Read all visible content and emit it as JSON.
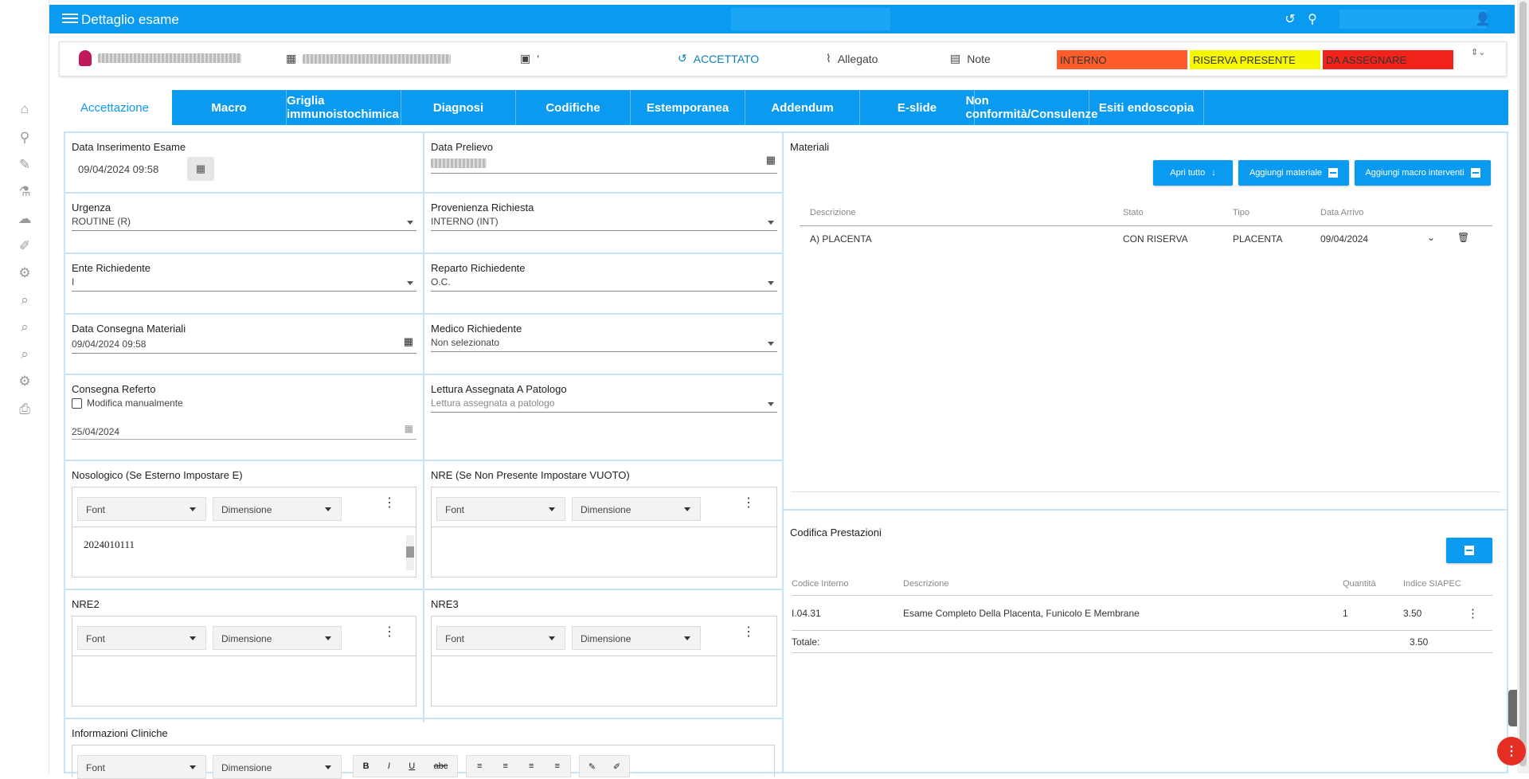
{
  "app": {
    "title": "Dettaglio esame"
  },
  "header": {
    "patient_name_hidden": "",
    "date_hidden": "",
    "folder_value": "'",
    "status": "ACCETTATO",
    "attachment_label": "Allegato",
    "notes_label": "Note",
    "chips": [
      {
        "label": "INTERNO",
        "color": "#ff5c2b"
      },
      {
        "label": "RISERVA PRESENTE",
        "color": "#f6f600"
      },
      {
        "label": "DA ASSEGNARE",
        "color": "#f2231a"
      }
    ]
  },
  "tabs": [
    "Accettazione",
    "Macro",
    "Griglia immunoistochimica",
    "Diagnosi",
    "Codifiche",
    "Estemporanea",
    "Addendum",
    "E-slide",
    "Non conformità/Consulenze",
    "Esiti endoscopia"
  ],
  "form": {
    "data_inserimento": {
      "label": "Data Inserimento Esame",
      "value": "09/04/2024 09:58"
    },
    "data_prelievo": {
      "label": "Data Prelievo"
    },
    "urgenza": {
      "label": "Urgenza",
      "value": "ROUTINE (R)"
    },
    "provenienza": {
      "label": "Provenienza Richiesta",
      "value": "INTERNO (INT)"
    },
    "ente": {
      "label": "Ente Richiedente",
      "value": "I"
    },
    "reparto": {
      "label": "Reparto Richiedente",
      "value": "O.C."
    },
    "consegna_materiali": {
      "label": "Data Consegna Materiali",
      "value": "09/04/2024 09:58"
    },
    "medico": {
      "label": "Medico Richiedente",
      "value": "Non selezionato"
    },
    "consegna_referto": {
      "label": "Consegna Referto",
      "checkbox_label": "Modifica manualmente",
      "value": "25/04/2024"
    },
    "lettura": {
      "label": "Lettura Assegnata A Patologo",
      "placeholder": "Lettura assegnata a patologo"
    },
    "nosologico": {
      "label": "Nosologico (Se Esterno Impostare E)",
      "value": "2024010111"
    },
    "nre": {
      "label": "NRE (Se Non Presente Impostare VUOTO)"
    },
    "nre2": {
      "label": "NRE2"
    },
    "nre3": {
      "label": "NRE3"
    },
    "info_cliniche": {
      "label": "Informazioni Cliniche"
    },
    "editor": {
      "font": "Font",
      "size": "Dimensione"
    }
  },
  "materiali": {
    "title": "Materiali",
    "buttons": {
      "apri": "Apri tutto",
      "aggiungi": "Aggiungi materiale",
      "macro": "Aggiungi macro interventi"
    },
    "columns": [
      "Descrizione",
      "Stato",
      "Tipo",
      "Data Arrivo"
    ],
    "rows": [
      {
        "descrizione": "A) PLACENTA",
        "stato": "CON RISERVA",
        "tipo": "PLACENTA",
        "data": "09/04/2024"
      }
    ]
  },
  "codifica": {
    "title": "Codifica Prestazioni",
    "columns": [
      "Codice Interno",
      "Descrizione",
      "Quantità",
      "Indice SIAPEC"
    ],
    "rows": [
      {
        "codice": "I.04.31",
        "descrizione": "Esame Completo Della Placenta, Funicolo E Membrane",
        "quantita": "1",
        "indice": "3.50"
      }
    ],
    "totale_label": "Totale:",
    "totale_value": "3.50"
  }
}
